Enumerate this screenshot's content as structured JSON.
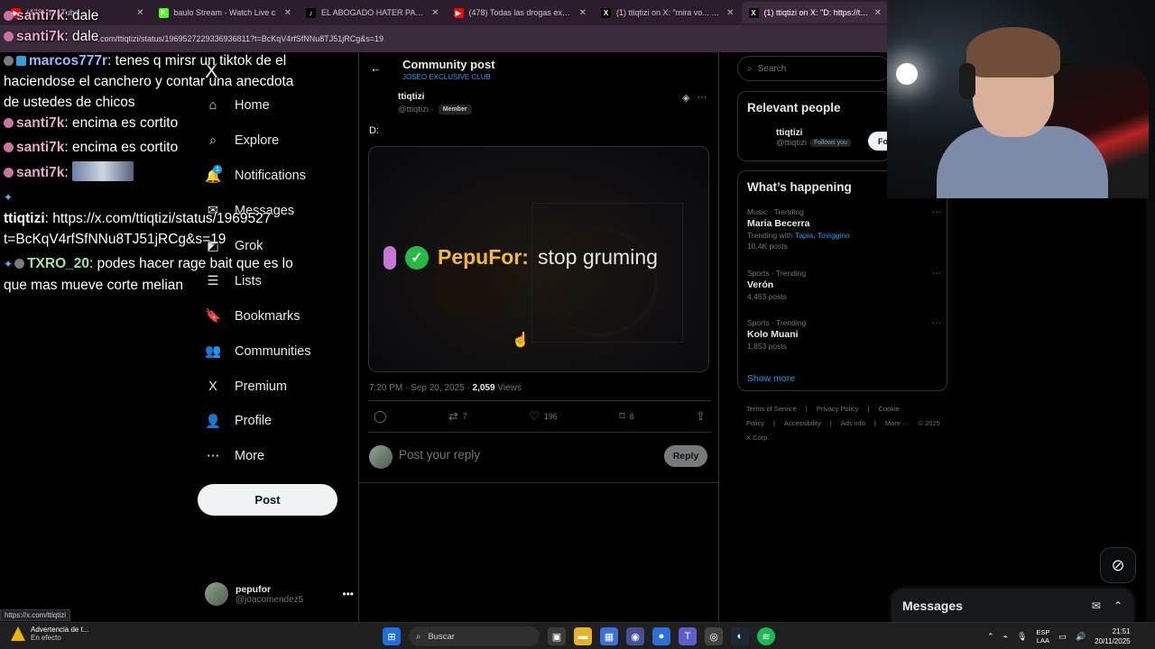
{
  "browser": {
    "tabs": [
      {
        "title": "(478) YouTube",
        "color": "#ff0000",
        "glyph": "▶"
      },
      {
        "title": "baulo Stream - Watch Live c",
        "color": "#53fc18",
        "glyph": "K"
      },
      {
        "title": "EL ABOGADO HATER PART2 #p",
        "color": "#000000",
        "glyph": "♪"
      },
      {
        "title": "(478) Todas las drogas explicad",
        "color": "#ff0000",
        "glyph": "▶"
      },
      {
        "title": "(1) ttiqtizi on X: \"mira vo... https:",
        "color": "#000000",
        "glyph": "X"
      },
      {
        "title": "(1) ttiqtizi on X: \"D: https://t.co",
        "color": "#000000",
        "glyph": "X"
      }
    ],
    "url": "x.com/ttiqtizi/status/1969527229336936811?t=BcKqV4rfSfNNu8TJ51jRCg&s=19",
    "status_url": "https://x.com/ttiqtizi"
  },
  "chat": {
    "messages": [
      {
        "user": "santi7k",
        "text": ": dale"
      },
      {
        "user": "santi7k",
        "text": ": dale"
      },
      {
        "user": "marcos777r",
        "text": ": tenes q mirsr un tiktok de el haciendose el canchero y contar una anecdota de ustedes de chicos"
      },
      {
        "user": "santi7k",
        "text": ": encima es cortito"
      },
      {
        "user": "santi7k",
        "text": ": encima es cortito"
      },
      {
        "user": "santi7k",
        "text": ":"
      },
      {
        "user": "ttiqtizi",
        "text": ": https://x.com/ttiqtizi/status/1969527 t=BcKqV4rfSfNNu8TJ51jRCg&s=19"
      },
      {
        "user": "TXRO_20",
        "text": ": podes hacer rage bait que es lo que mas mueve corte melian"
      }
    ]
  },
  "sidebar": {
    "logo": "X",
    "items": [
      {
        "label": "Home",
        "icon": "⌂"
      },
      {
        "label": "Explore",
        "icon": "⌕"
      },
      {
        "label": "Notifications",
        "icon": "🔔"
      },
      {
        "label": "Messages",
        "icon": "✉"
      },
      {
        "label": "Grok",
        "icon": "◩"
      },
      {
        "label": "Lists",
        "icon": "☰"
      },
      {
        "label": "Bookmarks",
        "icon": "🔖"
      },
      {
        "label": "Communities",
        "icon": "👥"
      },
      {
        "label": "Premium",
        "icon": "X"
      },
      {
        "label": "Profile",
        "icon": "👤"
      },
      {
        "label": "More",
        "icon": "⋯"
      }
    ],
    "notification_count": "1",
    "post_label": "Post",
    "account": {
      "name": "pepufor",
      "handle": "@joacomendez5"
    }
  },
  "post": {
    "header_title": "Community post",
    "community": "JOSEO EXCLUSIVE CLUB",
    "author_name": "ttiqtizi",
    "author_handle": "@ttiqtizi ·",
    "member_badge": "Member",
    "text": "D:",
    "media_caption_user": "PepuFor:",
    "media_caption_text": "stop gruming",
    "time": "7:20 PM · Sep 20, 2025 ·",
    "views_count": "2,059",
    "views_label": "Views",
    "retweets": "7",
    "likes": "196",
    "bookmarks": "8",
    "reply_placeholder": "Post your reply",
    "reply_button": "Reply"
  },
  "right": {
    "search_placeholder": "Search",
    "relevant_title": "Relevant people",
    "relevant_person": {
      "name": "ttiqtizi",
      "handle": "@ttiqtizi",
      "follows": "Follows you",
      "button": "Fo"
    },
    "happening_title": "What’s happening",
    "trends": [
      {
        "category": "Music · Trending",
        "name": "Maria Becerra",
        "extra_prefix": "Trending with",
        "extra_links": "Tapia, Tovigginο"
      },
      {
        "category": "Sports · Trending",
        "name": "Verón",
        "extra_prefix": "4,463 posts",
        "extra_links": ""
      },
      {
        "category": "Sports · Trending",
        "name": "Kolo Muani",
        "extra_prefix": "1,853 posts",
        "extra_links": ""
      }
    ],
    "trend1_posts": "10.4K posts",
    "show_more": "Show more",
    "footer": [
      "Terms of Service",
      "|",
      "Privacy Policy",
      "|",
      "Cookie Policy",
      "|",
      "Accessibility",
      "|",
      "Ads info",
      "|",
      "More ···",
      "© 2025 X Corp."
    ]
  },
  "messages_drawer": {
    "title": "Messages"
  },
  "taskbar": {
    "warning_title": "Advertencia de t...",
    "warning_sub": "En efecto",
    "search_placeholder": "Buscar",
    "lang_top": "ESP",
    "lang_bottom": "LAA",
    "time": "21:51",
    "date": "20/11/2025"
  }
}
